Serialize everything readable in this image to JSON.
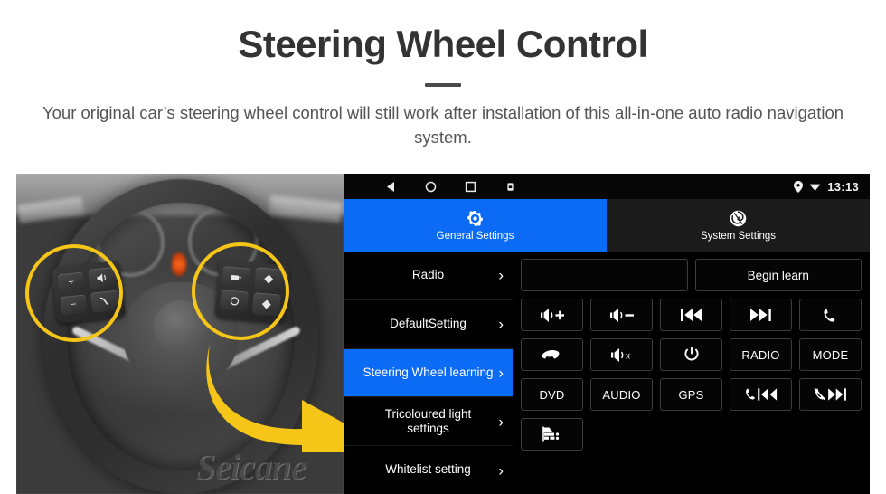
{
  "header": {
    "title": "Steering Wheel Control",
    "subtitle": "Your original car’s steering wheel control will still work after installation of this all-in-one auto radio navigation system."
  },
  "photo": {
    "watermark": "Seicane",
    "highlight_color": "#F5C518",
    "arrow_color": "#F5C518",
    "left_circle_name": "left-steering-controls-highlight",
    "right_circle_name": "right-steering-controls-highlight"
  },
  "tablet": {
    "statusbar": {
      "time": "13:13",
      "nav": [
        "back-icon",
        "home-icon",
        "recents-icon",
        "screenshot-icon"
      ],
      "indicators": [
        "location-pin-icon",
        "wifi-icon"
      ]
    },
    "tabs": [
      {
        "label": "General Settings",
        "icon": "gear-icon",
        "active": true,
        "color": "#0c6bf5"
      },
      {
        "label": "System Settings",
        "icon": "swirl-logo-icon",
        "active": false,
        "color": "#1b1b1b"
      }
    ],
    "menu": [
      {
        "label": "Radio",
        "chevron": "›",
        "active": false
      },
      {
        "label": "DefaultSetting",
        "chevron": "›",
        "active": false
      },
      {
        "label": "Steering Wheel learning",
        "chevron": "›",
        "active": true
      },
      {
        "label": "Tricoloured light settings",
        "chevron": "›",
        "active": false
      },
      {
        "label": "Whitelist setting",
        "chevron": "›",
        "active": false
      }
    ],
    "panel": {
      "input_value": "",
      "begin_learn_label": "Begin learn",
      "buttons": [
        {
          "name": "volume-up-button",
          "label": "",
          "icon": "volume-plus-icon"
        },
        {
          "name": "volume-down-button",
          "label": "",
          "icon": "volume-minus-icon"
        },
        {
          "name": "previous-track-button",
          "label": "",
          "icon": "prev-track-icon"
        },
        {
          "name": "next-track-button",
          "label": "",
          "icon": "next-track-icon"
        },
        {
          "name": "call-answer-button",
          "label": "",
          "icon": "phone-icon"
        },
        {
          "name": "call-hangup-button",
          "label": "",
          "icon": "phone-hangup-icon"
        },
        {
          "name": "mute-button",
          "label": "",
          "icon": "volume-mute-icon"
        },
        {
          "name": "power-button",
          "label": "",
          "icon": "power-icon"
        },
        {
          "name": "radio-button",
          "label": "RADIO",
          "icon": ""
        },
        {
          "name": "mode-button",
          "label": "MODE",
          "icon": ""
        },
        {
          "name": "dvd-button",
          "label": "DVD",
          "icon": ""
        },
        {
          "name": "audio-button",
          "label": "AUDIO",
          "icon": ""
        },
        {
          "name": "gps-button",
          "label": "GPS",
          "icon": ""
        },
        {
          "name": "call-previous-button",
          "label": "",
          "icon": "phone-prev-icon"
        },
        {
          "name": "callend-next-button",
          "label": "",
          "icon": "phone-off-next-icon"
        },
        {
          "name": "car-settings-button",
          "label": "",
          "icon": "car-icon"
        }
      ]
    }
  }
}
